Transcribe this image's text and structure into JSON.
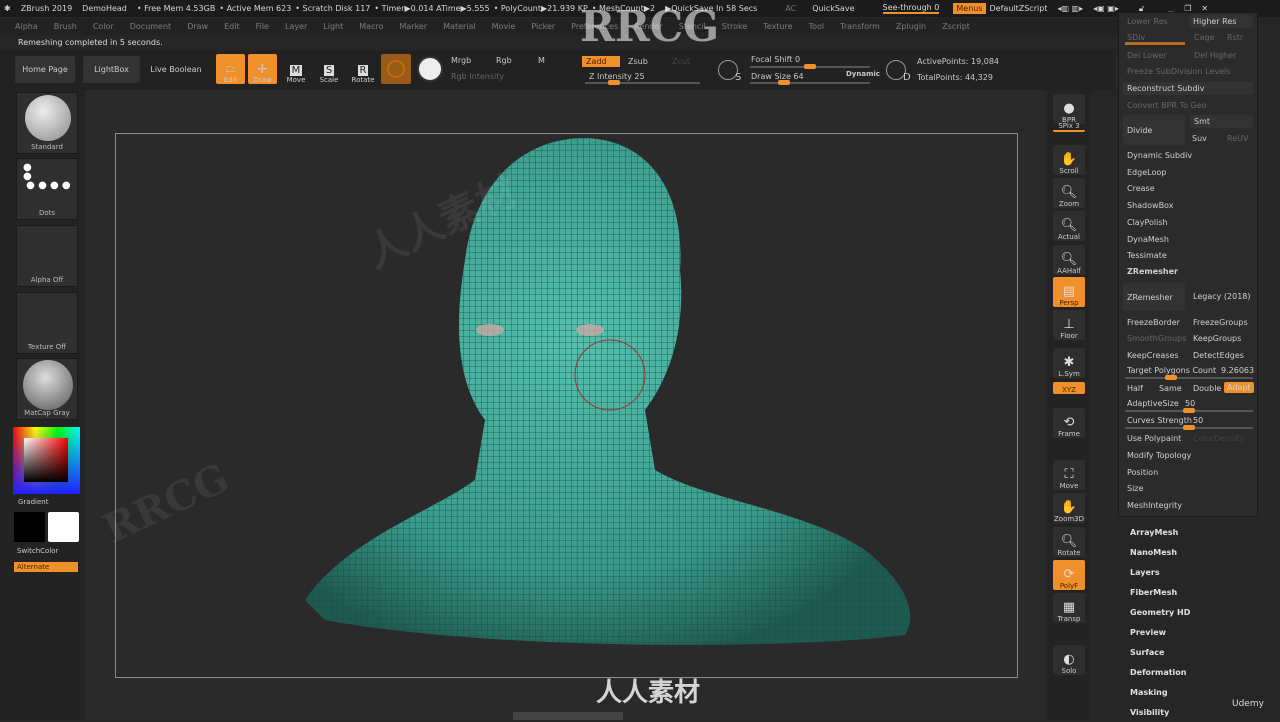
{
  "titlebar": {
    "app": "ZBrush 2019",
    "doc": "DemoHead",
    "free_mem": "• Free Mem 4.53GB",
    "active_mem": "• Active Mem 623",
    "scratch": "• Scratch Disk 117",
    "timer": "• Timer▶0.014 ATime▶5.555",
    "polycount": "• PolyCount▶21.939 KP",
    "meshcount": "• MeshCount▶2",
    "quicksave_in": "▶QuickSave In 58 Secs",
    "ac": "AC",
    "quicksave": "QuickSave",
    "seethrough": "See-through  0",
    "menus": "Menus",
    "script": "DefaultZScript"
  },
  "menu": [
    "Alpha",
    "Brush",
    "Color",
    "Document",
    "Draw",
    "Edit",
    "File",
    "Layer",
    "Light",
    "Macro",
    "Marker",
    "Material",
    "Movie",
    "Picker",
    "Preferences",
    "Render",
    "Stencil",
    "Stroke",
    "Texture",
    "Tool",
    "Transform",
    "Zplugin",
    "Zscript"
  ],
  "status": "Remeshing completed in 5 seconds.",
  "toolbar": {
    "home": "Home Page",
    "lightbox": "LightBox",
    "liveboolean": "Live Boolean",
    "edit": "Edit",
    "draw": "Draw",
    "move": "Move",
    "scale": "Scale",
    "rotate": "Rotate",
    "mrgb": "Mrgb",
    "rgb": "Rgb",
    "m": "M",
    "rgb_intensity": "Rgb Intensity",
    "zadd": "Zadd",
    "zsub": "Zsub",
    "zcut": "Zcut",
    "z_intensity": "Z Intensity 25",
    "focal_shift": "Focal Shift 0",
    "draw_size": "Draw Size 64",
    "dynamic": "Dynamic",
    "s": "S",
    "d": "D",
    "active_points": "ActivePoints: 19,084",
    "total_points": "TotalPoints: 44,329",
    "z_intensity_value": 25,
    "focal_shift_value": 0,
    "draw_size_value": 64
  },
  "leftshelf": {
    "brush": "Standard",
    "stroke": "Dots",
    "alpha": "Alpha Off",
    "texture": "Texture Off",
    "material": "MatCap Gray",
    "gradient": "Gradient",
    "switchcolor": "SwitchColor",
    "alternate": "Alternate"
  },
  "rightshelf": [
    "BPR",
    "SPix 3",
    "Scroll",
    "Zoom",
    "Actual",
    "AAHalf",
    "Persp",
    "Floor",
    "L.Sym",
    "XYZ",
    "Frame",
    "Move",
    "Zoom3D",
    "Rotate",
    "PolyF",
    "Transp",
    "Solo"
  ],
  "panel": {
    "lower_res": "Lower Res",
    "higher_res": "Higher Res",
    "sdiv": "SDiv",
    "cage": "Cage",
    "rstr": "Rstr",
    "del_lower": "Del Lower",
    "del_higher": "Del Higher",
    "freeze_subdiv": "Freeze SubDivision Levels",
    "reconstruct": "Reconstruct Subdiv",
    "convert_bpr": "Convert BPR To Geo",
    "divide": "Divide",
    "smt": "Smt",
    "suv": "Suv",
    "rsplit": "ReUV",
    "items": [
      "Dynamic Subdiv",
      "EdgeLoop",
      "Crease",
      "ShadowBox",
      "ClayPolish",
      "DynaMesh",
      "Tessimate"
    ],
    "zremesher_header": "ZRemesher",
    "zremesher": "ZRemesher",
    "legacy": "Legacy (2018)",
    "freezeborder": "FreezeBorder",
    "freezegroups": "FreezeGroups",
    "smoothgroups": "SmoothGroups",
    "keepgroups": "KeepGroups",
    "keepcreases": "KeepCreases",
    "detectedges": "DetectEdges",
    "target": "Target Polygons Count",
    "target_value": "9.26063",
    "half": "Half",
    "same": "Same",
    "double": "Double",
    "adapt": "Adapt",
    "adaptive": "AdaptiveSize",
    "adaptive_value": "50",
    "curves": "Curves Strength",
    "curves_value": "50",
    "polypaint": "Use Polypaint",
    "colordensity": "ColorDensity",
    "more": [
      "Modify Topology",
      "Position",
      "Size",
      "MeshIntegrity"
    ]
  },
  "sublist": [
    "ArrayMesh",
    "NanoMesh",
    "Layers",
    "FiberMesh",
    "Geometry HD",
    "Preview",
    "Surface",
    "Deformation",
    "Masking",
    "Visibility"
  ],
  "watermark": {
    "rrcg": "RRCG",
    "cn": "人人素材",
    "udemy": "Udemy"
  },
  "colors": {
    "accent": "#f0902a",
    "mesh": "#3fa595"
  }
}
